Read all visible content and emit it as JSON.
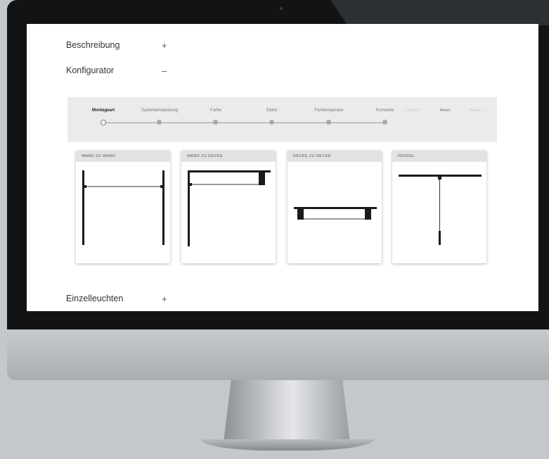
{
  "accordion": [
    {
      "title": "Beschreibung",
      "toggle": "+"
    },
    {
      "title": "Konfigurator",
      "toggle": "–"
    },
    {
      "title": "Einzelleuchten",
      "toggle": "+"
    }
  ],
  "stepper": {
    "steps": [
      {
        "label": "Montageart",
        "active": true
      },
      {
        "label": "Systemeinspeisung",
        "active": false
      },
      {
        "label": "Farbe",
        "active": false
      },
      {
        "label": "Editor",
        "active": false
      },
      {
        "label": "Farbtemperatur",
        "active": false
      },
      {
        "label": "Konverter",
        "active": false
      }
    ],
    "back_label": "< Zurück",
    "reset_label": "Reset",
    "next_label": "Weiter >"
  },
  "mounting_options": [
    {
      "label": "WAND ZU WAND",
      "icon": "wall-to-wall-icon"
    },
    {
      "label": "WAND ZU DECKE",
      "icon": "wall-to-ceiling-icon"
    },
    {
      "label": "DECKE ZU DECKE",
      "icon": "ceiling-to-ceiling-icon"
    },
    {
      "label": "PENDEL",
      "icon": "pendant-icon"
    }
  ]
}
